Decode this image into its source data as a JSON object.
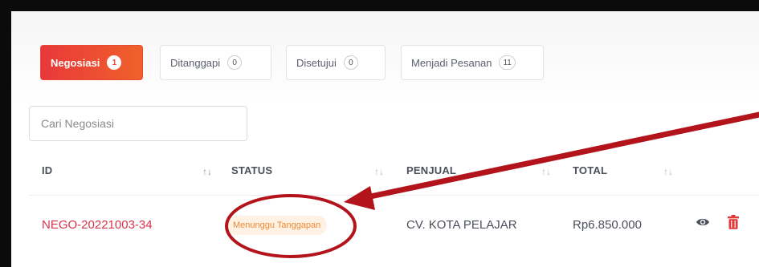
{
  "tabs": [
    {
      "label": "Negosiasi",
      "count": "1"
    },
    {
      "label": "Ditanggapi",
      "count": "0"
    },
    {
      "label": "Disetujui",
      "count": "0"
    },
    {
      "label": "Menjadi Pesanan",
      "count": "11"
    }
  ],
  "search": {
    "placeholder": "Cari Negosiasi"
  },
  "table": {
    "headers": [
      "ID",
      "STATUS",
      "PENJUAL",
      "TOTAL"
    ],
    "rows": [
      {
        "id": "NEGO-20221003-34",
        "status": "Menunggu Tanggapan",
        "seller": "CV. KOTA PELAJAR",
        "total": "Rp6.850.000"
      }
    ]
  },
  "colors": {
    "accent_gradient_start": "#e8383b",
    "accent_gradient_end": "#f0612a",
    "id_text": "#d8324a",
    "status_text": "#f08a34",
    "annotation": "#b3141b"
  },
  "icons": {
    "sort": "sort-icon",
    "view": "eye-icon",
    "delete": "trash-icon"
  }
}
